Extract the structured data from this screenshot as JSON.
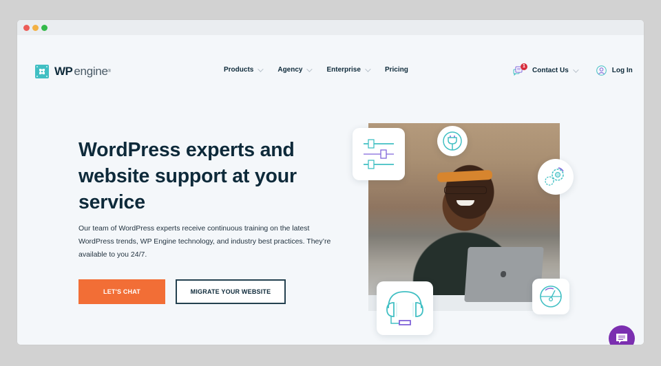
{
  "window": {
    "controls": [
      "close",
      "minimize",
      "maximize"
    ]
  },
  "brand": {
    "wp": "WP",
    "engine": "engine",
    "reg": "®",
    "logo_color": "#40bfc3"
  },
  "nav": {
    "items": [
      {
        "label": "Products",
        "has_dropdown": true
      },
      {
        "label": "Agency",
        "has_dropdown": true
      },
      {
        "label": "Enterprise",
        "has_dropdown": true
      },
      {
        "label": "Pricing",
        "has_dropdown": false
      }
    ],
    "contact": {
      "label": "Contact Us",
      "badge": "1",
      "has_dropdown": true,
      "icon": "chat-bubbles-icon"
    },
    "login": {
      "label": "Log In",
      "icon": "user-circle-icon"
    }
  },
  "hero": {
    "headline": "WordPress experts and website support at your service",
    "description": "Our team of WordPress experts receive continuous training on the latest WordPress trends, WP Engine technology, and industry best practices. They’re available to you 24/7.",
    "primary_button": "LET'S CHAT",
    "secondary_button": "MIGRATE YOUR WEBSITE",
    "image_alt": "Smiling man with headband and glasses sitting at a laptop in an office",
    "feature_icons": [
      "sliders-icon",
      "plug-icon",
      "gears-icon",
      "headset-icon",
      "speedometer-icon"
    ]
  },
  "colors": {
    "accent_orange": "#f26e36",
    "navy": "#0e2a3a",
    "teal": "#40bfc3",
    "purple": "#7b2fb0",
    "badge_red": "#d72d3b"
  },
  "chat_widget": {
    "icon": "chat-message-icon"
  }
}
